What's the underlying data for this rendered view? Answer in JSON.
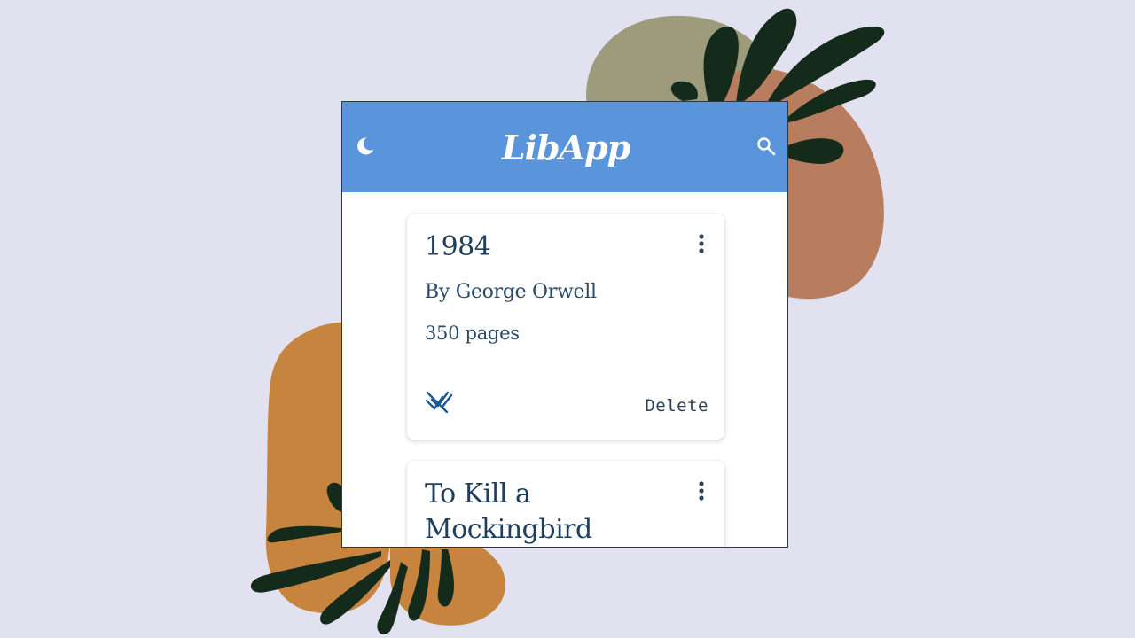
{
  "app": {
    "title": "LibApp",
    "theme_icon": "moon-icon",
    "search_icon": "search-icon"
  },
  "books": [
    {
      "title": "1984",
      "author": "By George Orwell",
      "pages": "350 pages",
      "read_icon": "mark-read-icon",
      "menu_icon": "more-vert-icon",
      "delete_label": "Delete"
    },
    {
      "title": "To Kill a Mockingbird",
      "menu_icon": "more-vert-icon"
    }
  ],
  "colors": {
    "appbar": "#5a95db",
    "background": "#e1e1ef",
    "text_primary": "#1f3f5f",
    "accent_icon": "#1d5a95",
    "blob_olive": "#9e9a7c",
    "blob_terracotta": "#b77d5e",
    "blob_orange": "#c6843f",
    "leaf_dark": "#142a1b"
  }
}
